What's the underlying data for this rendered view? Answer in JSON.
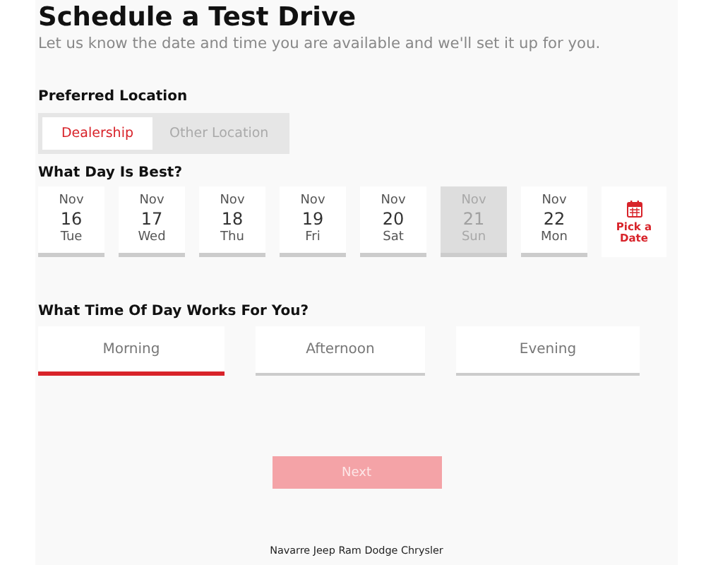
{
  "title": "Schedule a Test Drive",
  "subtitle": "Let us know the date and time you are available and we'll set it up for you.",
  "location": {
    "label": "Preferred Location",
    "options": [
      {
        "label": "Dealership",
        "selected": true
      },
      {
        "label": "Other Location",
        "selected": false
      }
    ]
  },
  "day": {
    "label": "What Day Is Best?",
    "days": [
      {
        "month": "Nov",
        "date": "16",
        "weekday": "Tue",
        "selected": false,
        "disabled": false
      },
      {
        "month": "Nov",
        "date": "17",
        "weekday": "Wed",
        "selected": false,
        "disabled": false
      },
      {
        "month": "Nov",
        "date": "18",
        "weekday": "Thu",
        "selected": false,
        "disabled": false
      },
      {
        "month": "Nov",
        "date": "19",
        "weekday": "Fri",
        "selected": false,
        "disabled": false
      },
      {
        "month": "Nov",
        "date": "20",
        "weekday": "Sat",
        "selected": false,
        "disabled": false
      },
      {
        "month": "Nov",
        "date": "21",
        "weekday": "Sun",
        "selected": false,
        "disabled": true
      },
      {
        "month": "Nov",
        "date": "22",
        "weekday": "Mon",
        "selected": false,
        "disabled": false
      }
    ],
    "pick_date": "Pick a Date"
  },
  "time": {
    "label": "What Time Of Day Works For You?",
    "options": [
      {
        "label": "Morning",
        "selected": true
      },
      {
        "label": "Afternoon",
        "selected": false
      },
      {
        "label": "Evening",
        "selected": false
      }
    ]
  },
  "next_button": {
    "label": "Next",
    "disabled": true
  },
  "footer": "Navarre Jeep Ram Dodge Chrysler"
}
